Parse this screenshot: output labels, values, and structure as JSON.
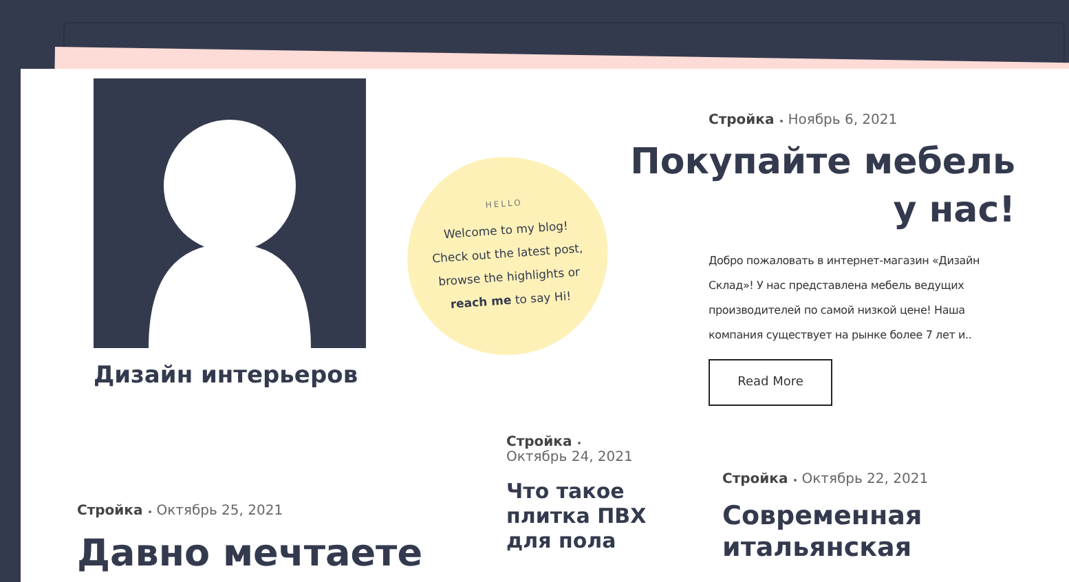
{
  "profile": {
    "kind": "picture",
    "title": "Дизайн интерьеров"
  },
  "greeting": {
    "label": "HELLO",
    "text": "Welcome to my blog! Check out the latest post, browse the highlights or **reach me** to say Hi!"
  },
  "featured": {
    "category": "Стройка",
    "date": "Ноябрь 6, 2021",
    "title": "Покупайте мебель у нас!",
    "excerpt": "Добро пожаловать в интернет-магазин «Дизайн Склад»! У нас представлена мебель ведущих производителей по самой низкой цене! Наша компания существует на рынке более 7 лет и..",
    "button": "Read More"
  },
  "posts": [
    {
      "category": "Стройка",
      "date": "Октябрь 25, 2021",
      "title": "Давно мечтаете",
      "kind": "large"
    },
    {
      "category": "Стройка",
      "date": "Октябрь 24, 2021",
      "title": "Что такое плитка ПВХ для пола",
      "kind": "small"
    },
    {
      "category": "Стройка",
      "date": "Октябрь 22, 2021",
      "title": "Современная итальянская",
      "kind": "medium"
    }
  ]
}
